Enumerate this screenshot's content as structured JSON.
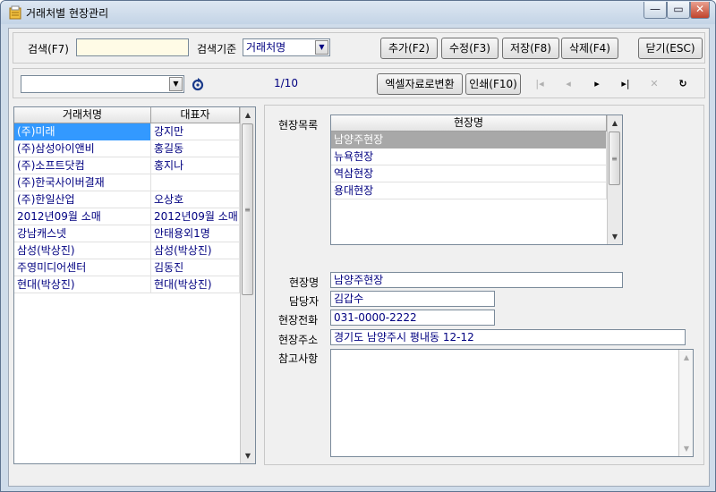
{
  "window": {
    "title": "거래처별 현장관리",
    "minimize": "—",
    "maximize": "▭",
    "close": "✕"
  },
  "search": {
    "label": "검색(F7)",
    "value": "",
    "criteria_label": "검색기준",
    "criteria_value": "거래처명"
  },
  "toolbar": {
    "add": "추가(F2)",
    "edit": "수정(F3)",
    "save": "저장(F8)",
    "delete": "삭제(F4)",
    "close": "닫기(ESC)"
  },
  "nav": {
    "filter_value": "",
    "page": "1/10",
    "excel": "엑셀자료로변환",
    "print": "인쇄(F10)"
  },
  "client_grid": {
    "headers": [
      "거래처명",
      "대표자"
    ],
    "rows": [
      [
        "(주)미래",
        "강지만"
      ],
      [
        "(주)삼성아이앤비",
        "홍길동"
      ],
      [
        "(주)소프트닷컴",
        "홍지나"
      ],
      [
        "(주)한국사이버결재",
        ""
      ],
      [
        "(주)한일산업",
        "오상호"
      ],
      [
        "2012년09월 소매",
        "2012년09월 소매"
      ],
      [
        "강남캐스넷",
        "안태용외1명"
      ],
      [
        "삼성(박상진)",
        "삼성(박상진)"
      ],
      [
        "주영미디어센터",
        "김동진"
      ],
      [
        "현대(박상진)",
        "현대(박상진)"
      ]
    ],
    "selected_index": 0
  },
  "site": {
    "list_label": "현장목록",
    "list_header": "현장명",
    "list": [
      "남양주현장",
      "뉴욕현장",
      "역삼현장",
      "용대현장"
    ],
    "selected_index": 0,
    "name_label": "현장명",
    "name_value": "남양주현장",
    "manager_label": "담당자",
    "manager_value": "김갑수",
    "phone_label": "현장전화",
    "phone_value": "031-0000-2222",
    "address_label": "현장주소",
    "address_value": "경기도 남양주시 평내동 12-12",
    "memo_label": "참고사항",
    "memo_value": ""
  },
  "colors": {
    "selected_row": "#3399ff",
    "selected_list": "#a8a8a8",
    "cell_text": "#000080",
    "window_frame": "#cfdcea"
  }
}
